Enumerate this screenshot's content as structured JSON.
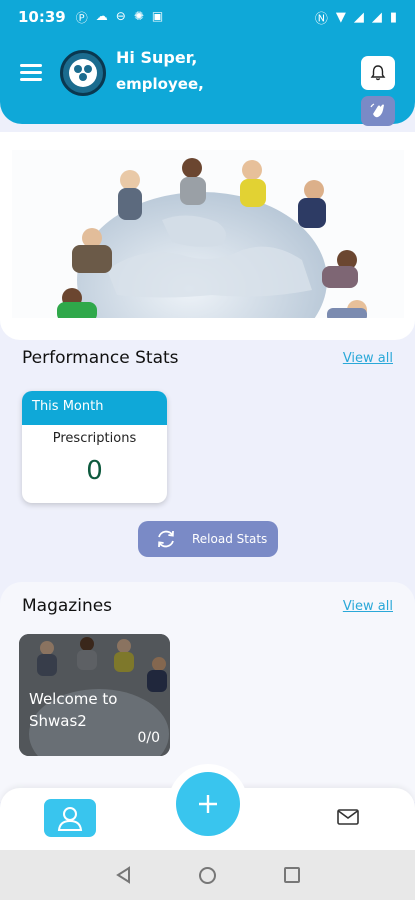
{
  "status_bar": {
    "time": "10:39",
    "left_icons": [
      "p-icon",
      "cloud-icon",
      "minus-circle-icon",
      "bug-icon",
      "image-icon"
    ],
    "right_icons": [
      "nfc-icon",
      "wifi-icon",
      "signal-icon",
      "signal-icon",
      "battery-icon"
    ]
  },
  "header": {
    "greeting_line1": "Hi Super,",
    "greeting_line2": "employee,",
    "bg_color": "#0fa8d8"
  },
  "performance": {
    "title": "Performance Stats",
    "view_all": "View all",
    "card": {
      "period": "This Month",
      "label": "Prescriptions",
      "value": "0"
    },
    "reload_label": "Reload Stats"
  },
  "magazines": {
    "title": "Magazines",
    "view_all": "View all",
    "items": [
      {
        "title": "Welcome to Shwas2",
        "count": "0/0"
      }
    ]
  },
  "colors": {
    "accent": "#0fa8d8",
    "secondary_button": "#7a8ac6",
    "fab": "#39c5ee",
    "stat_value": "#0e5a3e"
  }
}
